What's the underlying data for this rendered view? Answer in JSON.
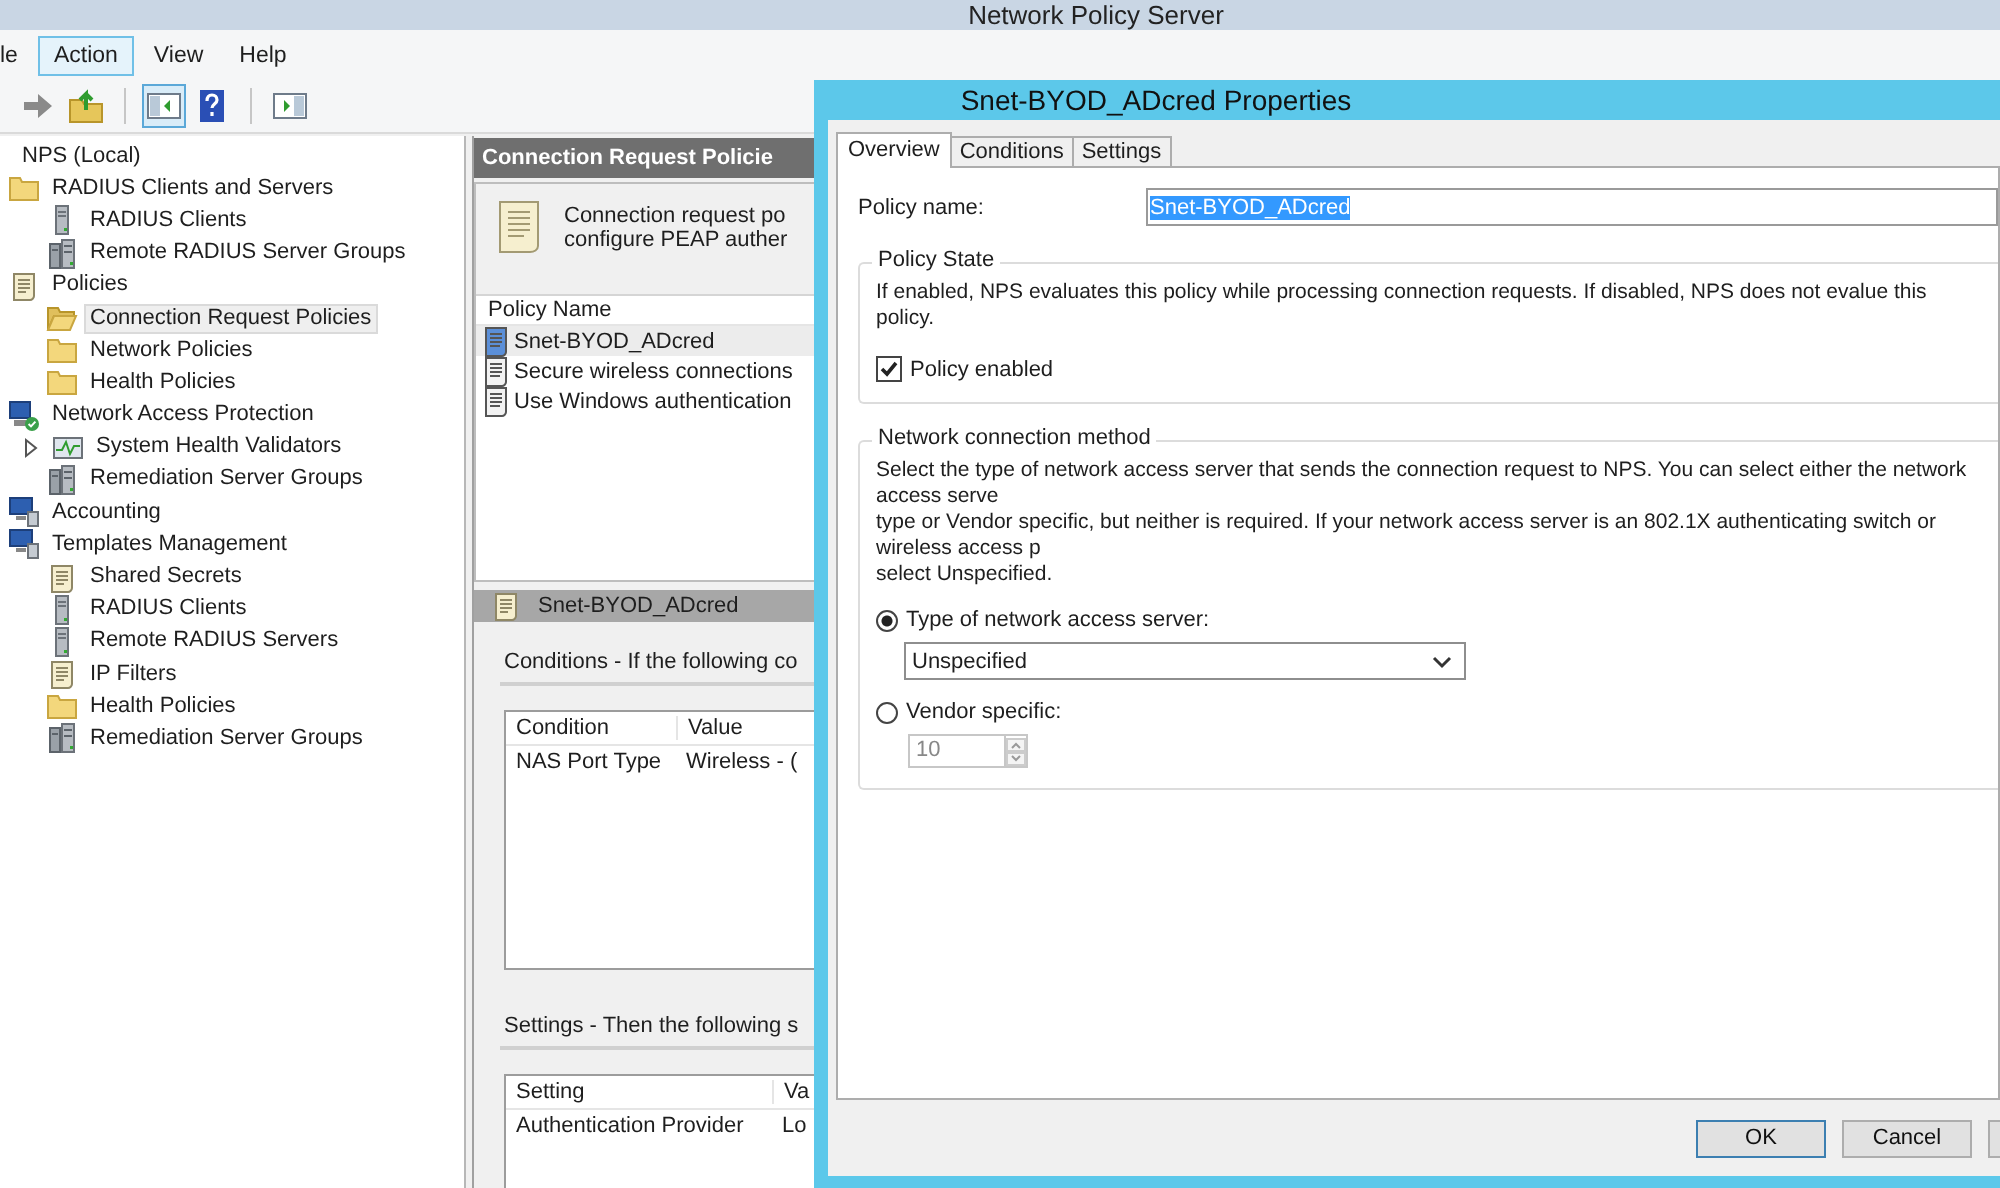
{
  "main_window": {
    "title": "Network Policy Server"
  },
  "menu": [
    {
      "label": "le",
      "selected": false
    },
    {
      "label": "Action",
      "selected": true
    },
    {
      "label": "View",
      "selected": false
    },
    {
      "label": "Help",
      "selected": false
    }
  ],
  "toolbar": [
    {
      "kind": "forward",
      "pressed": false
    },
    {
      "kind": "up",
      "pressed": false
    },
    {
      "kind": "tree",
      "pressed": true
    },
    {
      "kind": "help",
      "pressed": false
    },
    {
      "kind": "pane",
      "pressed": false
    }
  ],
  "tree": [
    {
      "label": "NPS (Local)",
      "selected": false,
      "children": [
        {
          "label": "RADIUS Clients and Servers",
          "kind": "folder",
          "selected": false,
          "children": [
            {
              "label": "RADIUS Clients",
              "kind": "server",
              "selected": false
            },
            {
              "label": "Remote RADIUS Server Groups",
              "kind": "server-group",
              "selected": false
            }
          ]
        },
        {
          "label": "Policies",
          "kind": "scroll",
          "selected": false,
          "children": [
            {
              "label": "Connection Request Policies",
              "kind": "folder-open",
              "selected": true
            },
            {
              "label": "Network Policies",
              "kind": "folder",
              "selected": false
            },
            {
              "label": "Health Policies",
              "kind": "folder",
              "selected": false
            }
          ]
        },
        {
          "label": "Network Access Protection",
          "kind": "nap",
          "selected": false,
          "children": [
            {
              "label": "System Health Validators",
              "kind": "chart",
              "selected": false,
              "expanded": false
            },
            {
              "label": "Remediation Server Groups",
              "kind": "server-group",
              "selected": false
            }
          ]
        },
        {
          "label": "Accounting",
          "kind": "computer",
          "selected": false
        },
        {
          "label": "Templates Management",
          "kind": "computer",
          "selected": false,
          "children": [
            {
              "label": "Shared Secrets",
              "kind": "scroll",
              "selected": false
            },
            {
              "label": "RADIUS Clients",
              "kind": "server",
              "selected": false
            },
            {
              "label": "Remote RADIUS Servers",
              "kind": "server",
              "selected": false
            },
            {
              "label": "IP Filters",
              "kind": "scroll",
              "selected": false
            },
            {
              "label": "Health Policies",
              "kind": "folder",
              "selected": false
            },
            {
              "label": "Remediation Server Groups",
              "kind": "server-group",
              "selected": false
            }
          ]
        }
      ]
    }
  ],
  "pane": {
    "header": "Connection Request Policie",
    "description": [
      "Connection request po",
      "configure PEAP auther"
    ],
    "list": {
      "column": "Policy Name",
      "rows": [
        {
          "name": "Snet-BYOD_ADcred",
          "selected": true
        },
        {
          "name": "Secure wireless connections",
          "selected": false
        },
        {
          "name": "Use Windows authentication",
          "selected": false
        }
      ]
    },
    "detail": {
      "title": "Snet-BYOD_ADcred",
      "conditions": {
        "heading": "Conditions - If the following co",
        "columns": [
          "Condition",
          "Value"
        ],
        "rows": [
          [
            "NAS Port Type",
            "Wireless - ("
          ]
        ]
      },
      "settings": {
        "heading": "Settings - Then the following s",
        "columns": [
          "Setting",
          "Va"
        ],
        "rows": [
          [
            "Authentication Provider",
            "Lo"
          ]
        ]
      }
    }
  },
  "dialog": {
    "title": "Snet-BYOD_ADcred Properties",
    "tabs": [
      {
        "label": "Overview",
        "selected": true
      },
      {
        "label": "Conditions",
        "selected": false
      },
      {
        "label": "Settings",
        "selected": false
      }
    ],
    "policy_name": {
      "label": "Policy name:",
      "value": "Snet-BYOD_ADcred"
    },
    "policy_state": {
      "heading": "Policy State",
      "text": "If enabled, NPS evaluates this policy while processing connection requests. If disabled, NPS does not evalue this policy.",
      "checkbox": {
        "label": "Policy enabled",
        "checked": true
      }
    },
    "connection_method": {
      "heading": "Network connection method",
      "description_lines": [
        "Select the type of network access server that sends the connection request to NPS. You can select either the network access serve",
        "type or Vendor specific, but neither is required.  If your network access server is an 802.1X authenticating switch or wireless access p",
        "select Unspecified."
      ],
      "options": [
        {
          "label": "Type of network access server:",
          "selected": true,
          "kind": "dropdown",
          "value": "Unspecified",
          "disabled": false
        },
        {
          "label": "Vendor specific:",
          "selected": false,
          "kind": "spinner",
          "value": "10",
          "disabled": true
        }
      ]
    },
    "buttons": [
      {
        "label": "OK",
        "default": true
      },
      {
        "label": "Cancel",
        "default": false
      },
      {
        "default": false
      }
    ]
  }
}
